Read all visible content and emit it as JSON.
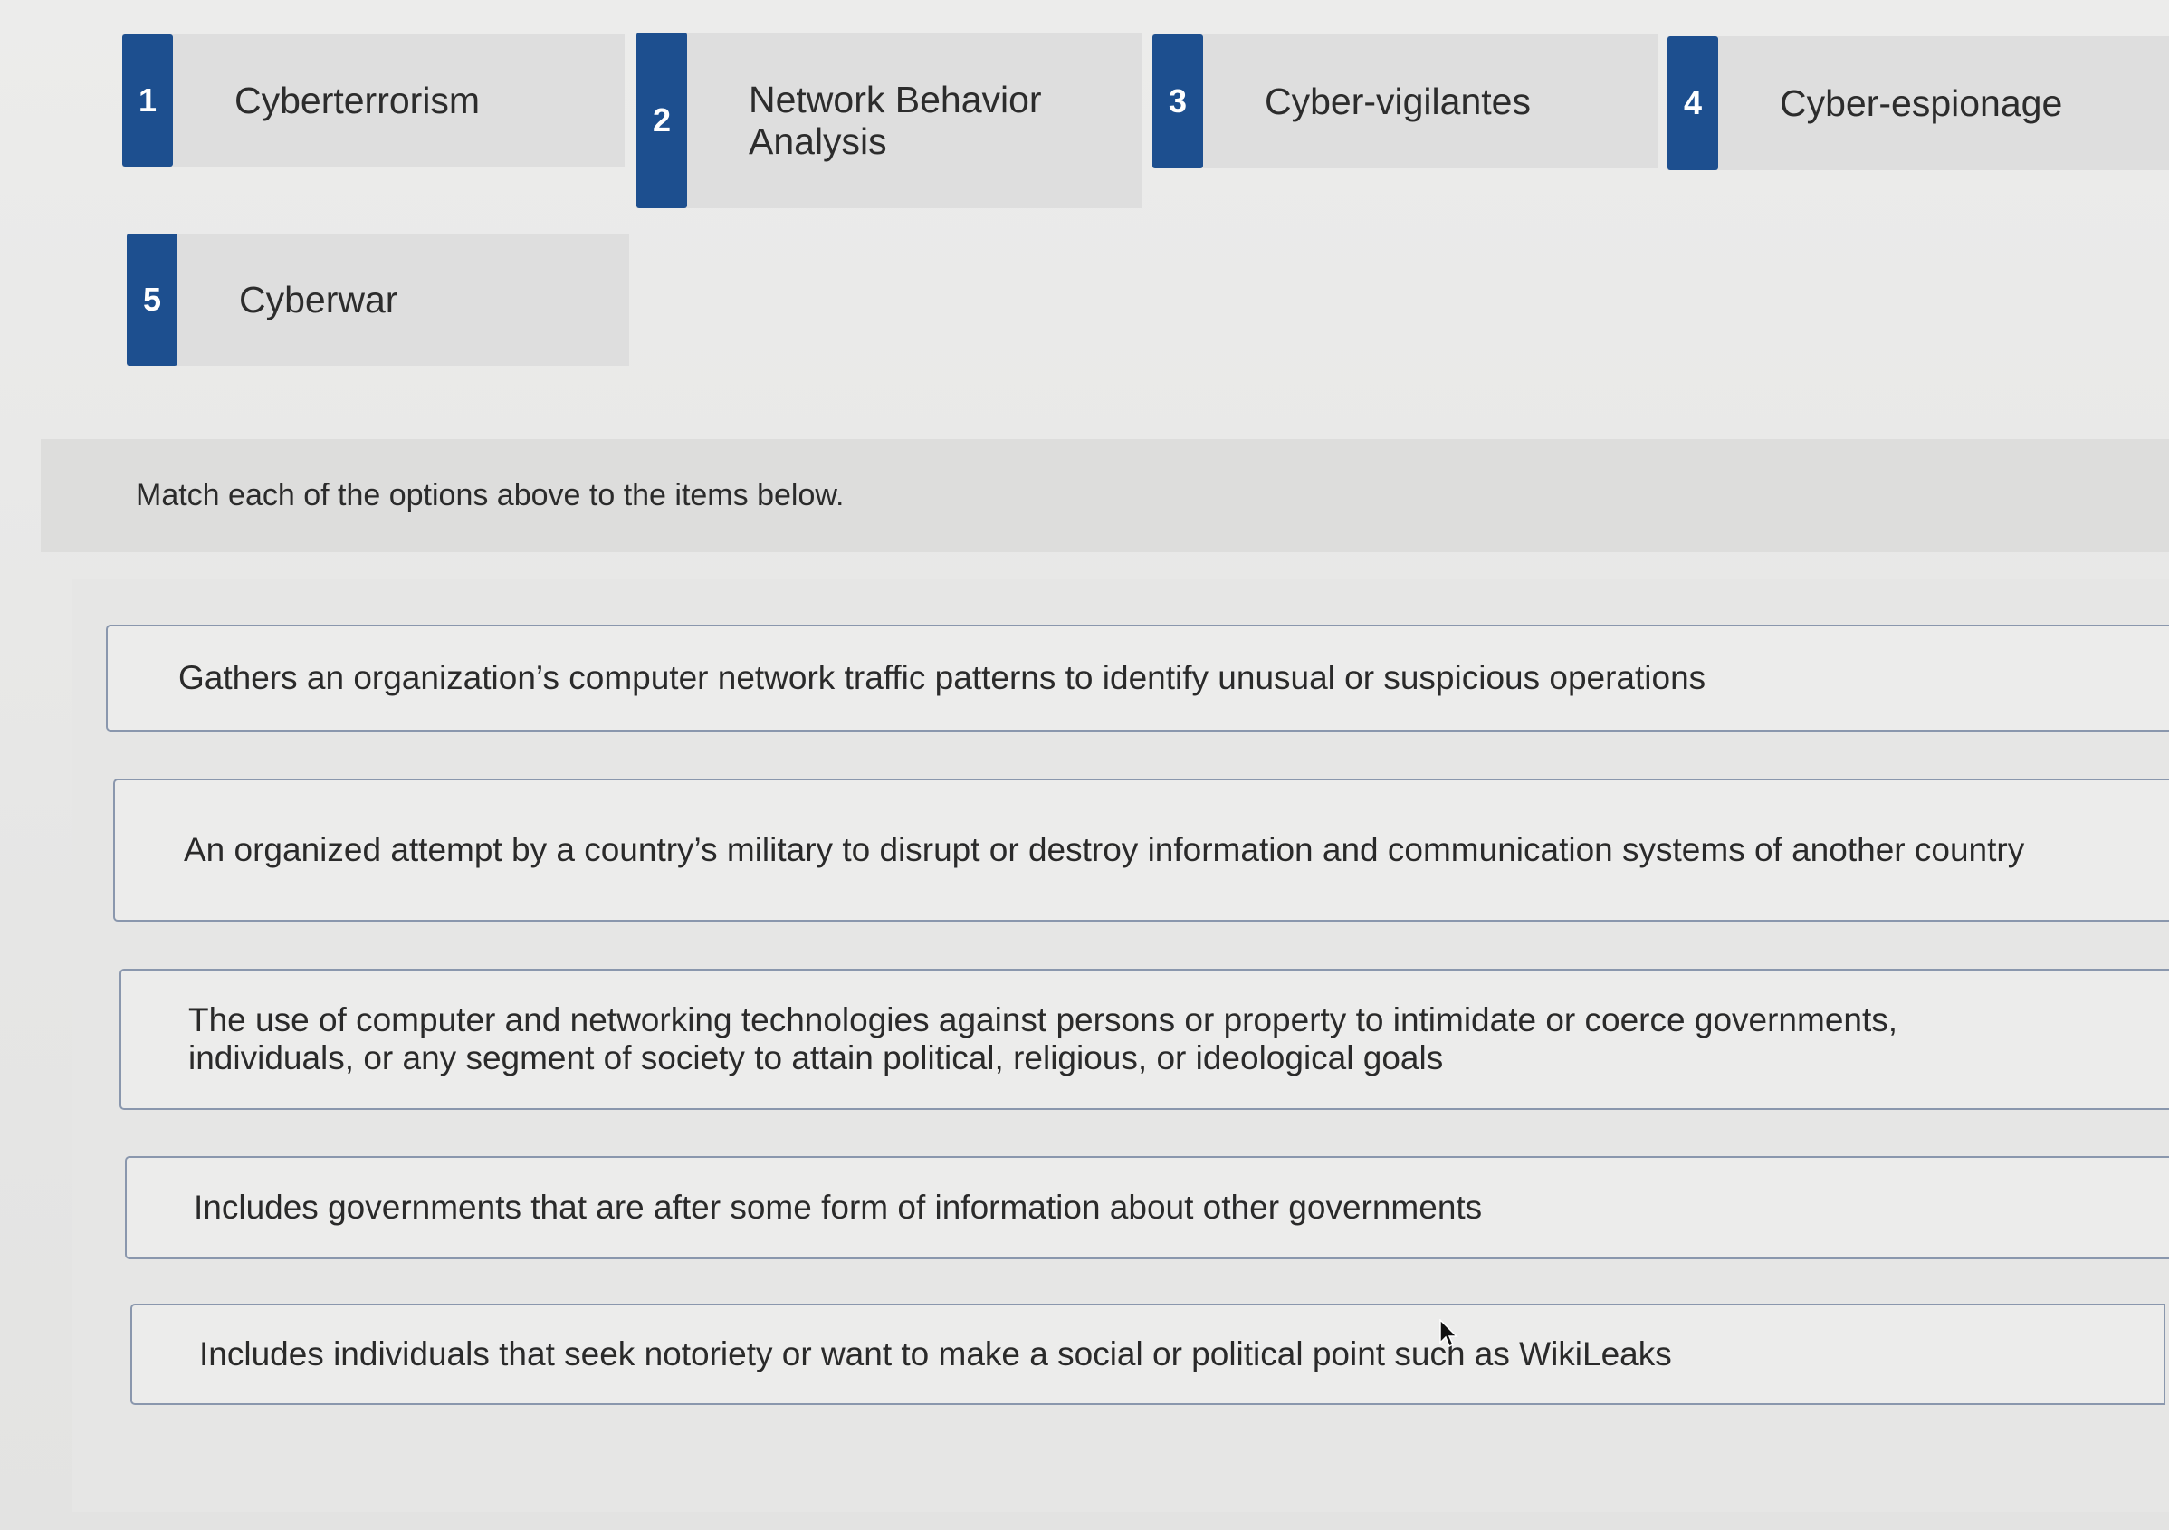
{
  "options": [
    {
      "number": "1",
      "label": "Cyberterrorism"
    },
    {
      "number": "2",
      "label": "Network Behavior Analysis"
    },
    {
      "number": "3",
      "label": "Cyber-vigilantes"
    },
    {
      "number": "4",
      "label": "Cyber-espionage"
    },
    {
      "number": "5",
      "label": "Cyberwar"
    }
  ],
  "instruction": "Match each of the options above to the items below.",
  "targets": [
    {
      "text": "Gathers an organization’s computer network traffic patterns to identify unusual or suspicious operations"
    },
    {
      "text": "An organized attempt by a country’s military to disrupt or destroy information and communication systems of another country"
    },
    {
      "text": "The use of computer and networking technologies against persons or property to intimidate or coerce governments, individuals, or any segment of society to attain political, religious, or ideological goals"
    },
    {
      "text": "Includes governments that are after some form of information about other governments"
    },
    {
      "text": "Includes individuals that seek notoriety or want to make a social or political point such as WikiLeaks"
    }
  ],
  "colors": {
    "accent": "#1d4f8f",
    "tile_background": "#dedede",
    "target_border": "#8a97ad"
  }
}
